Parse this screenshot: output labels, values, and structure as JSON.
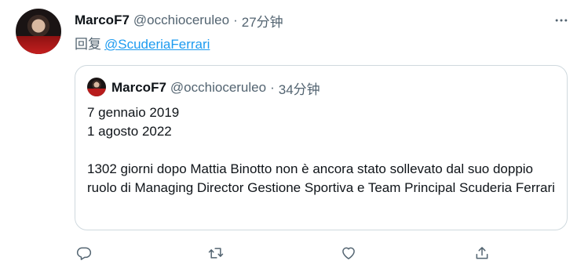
{
  "tweet": {
    "author_name": "MarcoF7",
    "author_handle": "@occhioceruleo",
    "separator": "·",
    "time": "27分钟",
    "reply_prefix": "回复",
    "reply_to": "@ScuderiaFerrari"
  },
  "quoted_tweet": {
    "author_name": "MarcoF7",
    "author_handle": "@occhioceruleo",
    "separator": "·",
    "time": "34分钟",
    "lines": {
      "line1": "7 gennaio 2019",
      "line2": "1 agosto 2022",
      "line3": "1302 giorni dopo Mattia Binotto non è ancora stato sollevato dal suo doppio ruolo di Managing Director Gestione Sportiva e Team Principal Scuderia Ferrari"
    }
  },
  "icons": {
    "more": "more-horizontal-icon",
    "reply": "reply-icon",
    "retweet": "retweet-icon",
    "like": "like-icon",
    "share": "share-icon"
  },
  "colors": {
    "link": "#1d9bf0",
    "secondary_text": "#536471",
    "border": "#cfd9de"
  }
}
